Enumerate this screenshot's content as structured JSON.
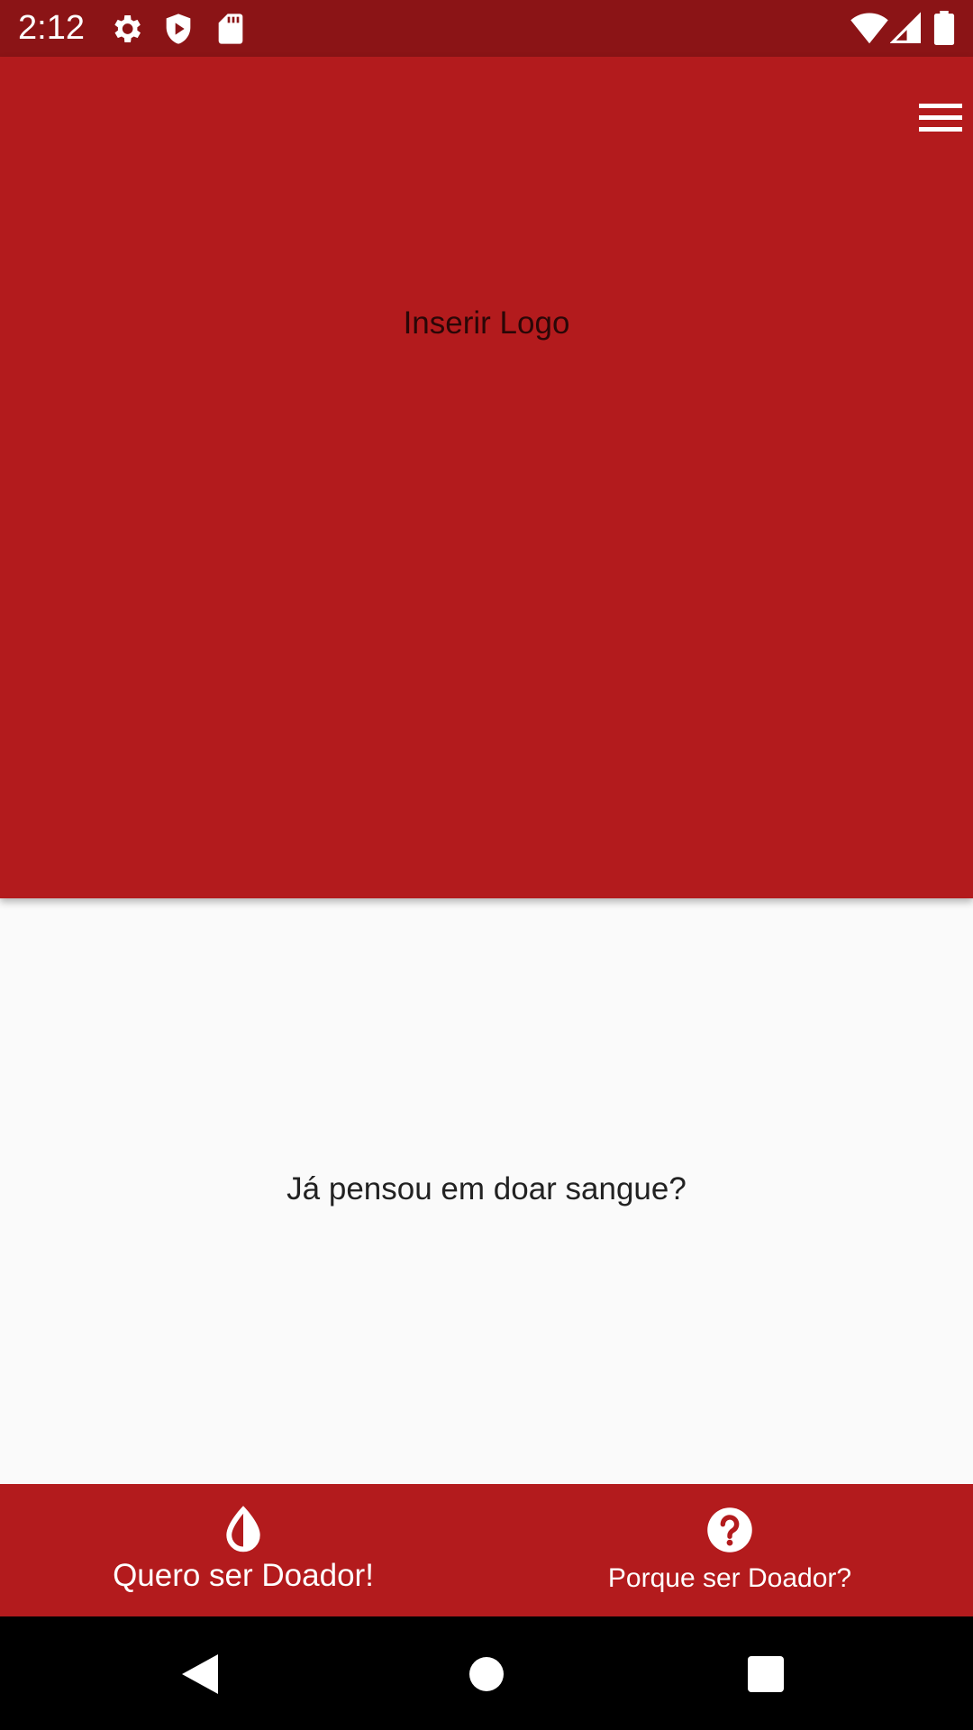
{
  "status_bar": {
    "time": "2:12",
    "icons": [
      "gear-icon",
      "shield-play-icon",
      "sd-card-icon",
      "wifi-icon",
      "signal-icon",
      "battery-icon"
    ],
    "background": "#8b1416"
  },
  "header": {
    "logo_placeholder": "Inserir Logo",
    "menu_icon": "hamburger-menu-icon",
    "background": "#b31b1d"
  },
  "main": {
    "prompt": "Já pensou em doar sangue?"
  },
  "bottom_nav": {
    "background": "#b31b1d",
    "items": [
      {
        "icon": "blood-drop-icon",
        "label": "Quero ser Doador!"
      },
      {
        "icon": "help-circle-icon",
        "label": "Porque ser Doador?"
      }
    ]
  },
  "system_nav": {
    "buttons": [
      "back-icon",
      "home-icon",
      "recents-icon"
    ]
  }
}
